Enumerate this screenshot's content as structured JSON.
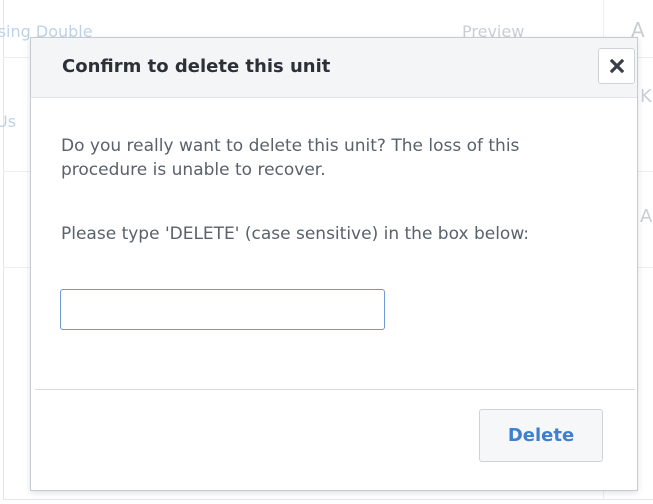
{
  "background": {
    "row1_text": "Using Double",
    "row1_right": "Preview",
    "row1_edge": "A",
    "row2_text": "Us",
    "row2_edge": "K",
    "row3_edge": "A"
  },
  "dialog": {
    "title": "Confirm to delete this unit",
    "close_icon": "close-x-icon",
    "message": "Do you really want to delete this unit? The loss of this procedure is unable to recover.",
    "instruction": "Please type 'DELETE' (case sensitive) in the box below:",
    "input_value": "",
    "input_placeholder": "",
    "delete_label": "Delete"
  },
  "colors": {
    "accent": "#3f7fd0",
    "input_border": "#6f9ad6",
    "header_bg": "#f4f5f7"
  }
}
